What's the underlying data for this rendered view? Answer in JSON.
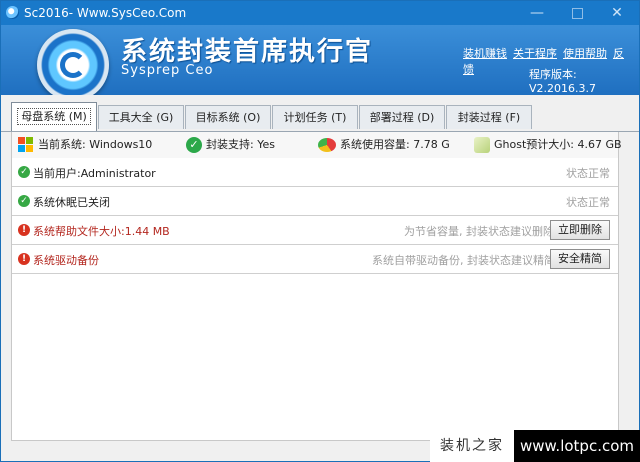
{
  "window": {
    "title": "Sc2016- Www.SysCeo.Com",
    "controls": {
      "minimize": "—",
      "close": "✕"
    }
  },
  "banner": {
    "title": "系统封装首席执行官",
    "subtitle": "Sysprep  Ceo",
    "links": [
      "装机赚钱",
      "关于程序",
      "使用帮助",
      "反馈"
    ],
    "version": "程序版本: V2.2016.3.7"
  },
  "tabs": [
    {
      "label": "母盘系统",
      "key": "(M)",
      "active": true
    },
    {
      "label": "工具大全",
      "key": "(G)",
      "active": false
    },
    {
      "label": "目标系统",
      "key": "(O)",
      "active": false
    },
    {
      "label": "计划任务",
      "key": "(T)",
      "active": false
    },
    {
      "label": "部署过程",
      "key": "(D)",
      "active": false
    },
    {
      "label": "封装过程",
      "key": "(F)",
      "active": false
    }
  ],
  "info": {
    "current_system": "当前系统: Windows10",
    "package_support": "封装支持: Yes",
    "system_usage": "系统使用容量: 7.78 G",
    "ghost_size": "Ghost预计大小: 4.67 GB"
  },
  "rows": [
    {
      "type": "ok",
      "label": "当前用户:Administrator",
      "status": "状态正常"
    },
    {
      "type": "ok",
      "label": "系统休眠已关闭",
      "status": "状态正常"
    },
    {
      "type": "warn",
      "label": "系统帮助文件大小:1.44 MB",
      "note": "为节省容量, 封装状态建议删除",
      "button": "立即删除"
    },
    {
      "type": "warn",
      "label": "系统驱动备份",
      "note": "系统自带驱动备份, 封装状态建议精简",
      "button": "安全精简"
    }
  ],
  "watermark": {
    "left": "装机之家",
    "right": "www.lotpc.com"
  },
  "colors": {
    "titlebar": "#1979ca",
    "banner": "#2f82d0",
    "ok": "#36a844",
    "warn": "#d8321f"
  }
}
